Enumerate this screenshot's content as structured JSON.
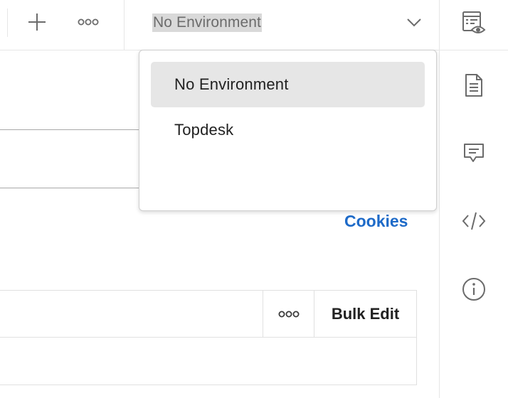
{
  "toolbar": {
    "add_icon": "plus-icon",
    "more_icon": "more-horizontal-icon"
  },
  "environment": {
    "selected": "No Environment",
    "chevron_icon": "chevron-down-icon",
    "quick_look_icon": "environment-quick-look-icon"
  },
  "dropdown": {
    "items": [
      {
        "label": "No Environment",
        "selected": true
      },
      {
        "label": "Topdesk",
        "selected": false
      }
    ]
  },
  "sidebar": {
    "icons": [
      "documentation-icon",
      "comments-icon",
      "code-icon",
      "info-icon"
    ]
  },
  "request": {
    "cookies_label": "Cookies",
    "params": {
      "more_icon": "more-horizontal-icon",
      "bulk_edit_label": "Bulk Edit"
    }
  },
  "colors": {
    "link": "#1d6ac8",
    "selected_item_bg": "#e6e6e6",
    "env_value_highlight": "#d9d9d9"
  }
}
